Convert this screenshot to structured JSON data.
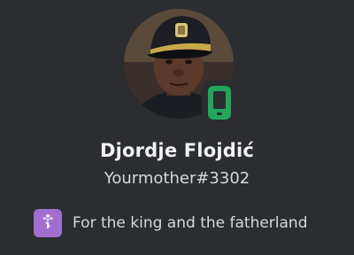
{
  "profile": {
    "display_name": "Djordje Flojdić",
    "username": "Yourmother#3302",
    "status_icon": "mobile-online-icon",
    "status_color": "#23a55a",
    "custom_status": {
      "emoji_icon": "orthodox-cross-icon",
      "emoji_glyph": "☦",
      "emoji_bg": "#a16ecf",
      "text": "For the king and the fatherland"
    }
  },
  "theme": {
    "background": "#2b2d31"
  }
}
